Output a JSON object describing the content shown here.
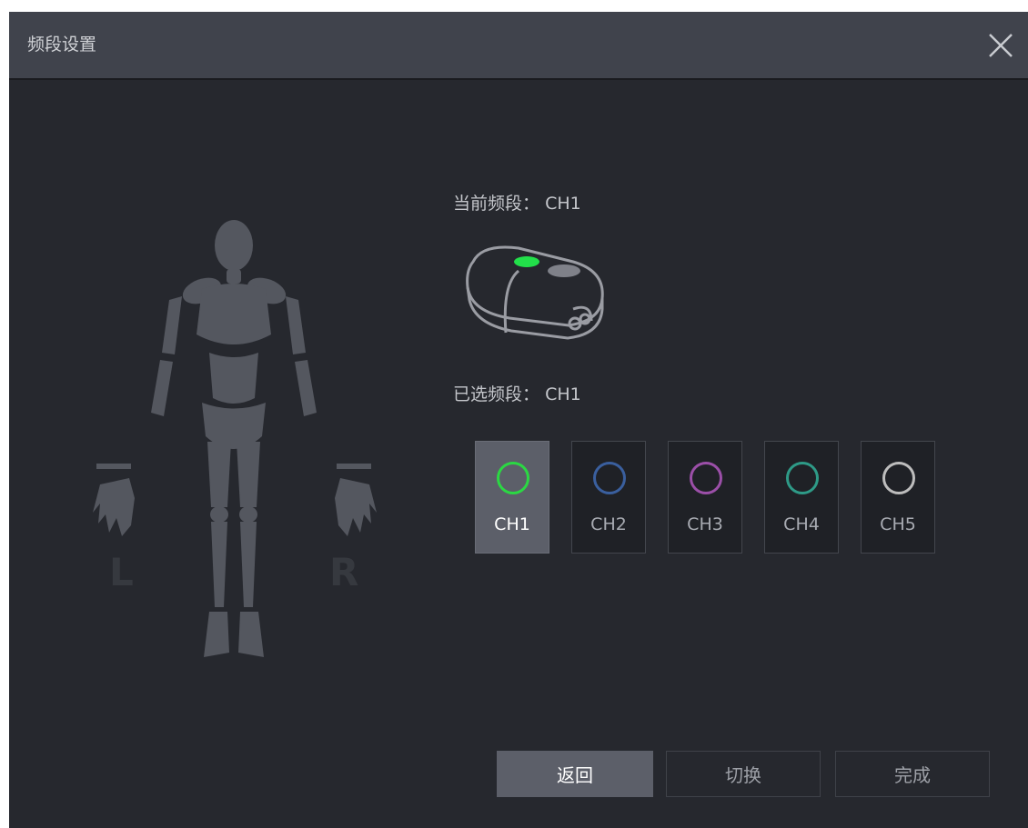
{
  "window": {
    "title": "频段设置"
  },
  "body_figure": {
    "left_label": "L",
    "right_label": "R"
  },
  "current_band": {
    "label": "当前频段：",
    "value": "CH1"
  },
  "selected_band": {
    "label": "已选频段：",
    "value": "CH1"
  },
  "channels": [
    {
      "label": "CH1",
      "color": "#2bd843",
      "selected": true
    },
    {
      "label": "CH2",
      "color": "#3a5f9e",
      "selected": false
    },
    {
      "label": "CH3",
      "color": "#9b4fa8",
      "selected": false
    },
    {
      "label": "CH4",
      "color": "#2e9a87",
      "selected": false
    },
    {
      "label": "CH5",
      "color": "#bdbdbd",
      "selected": false
    }
  ],
  "footer": {
    "back_label": "返回",
    "switch_label": "切换",
    "done_label": "完成"
  },
  "colors": {
    "titlebar": "#40434c",
    "background": "#26282e",
    "device_led": "#22e04a"
  }
}
